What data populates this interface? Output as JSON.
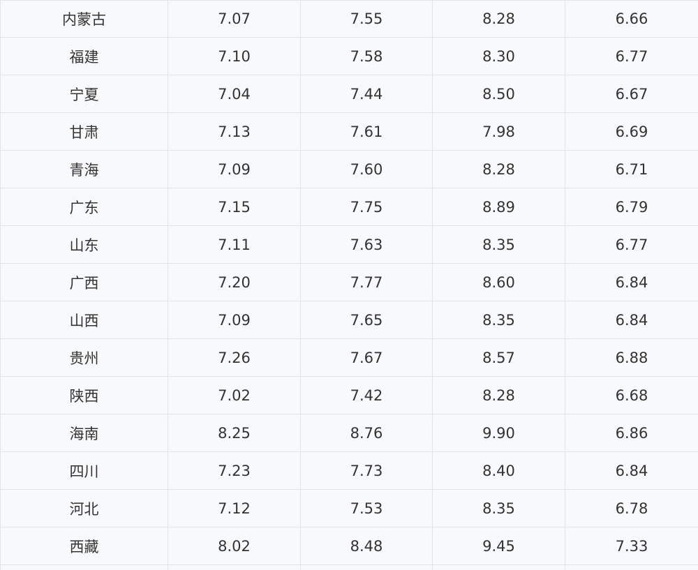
{
  "table": {
    "rows": [
      {
        "region": "内蒙古",
        "values": [
          "7.07",
          "7.55",
          "8.28",
          "6.66"
        ]
      },
      {
        "region": "福建",
        "values": [
          "7.10",
          "7.58",
          "8.30",
          "6.77"
        ]
      },
      {
        "region": "宁夏",
        "values": [
          "7.04",
          "7.44",
          "8.50",
          "6.67"
        ]
      },
      {
        "region": "甘肃",
        "values": [
          "7.13",
          "7.61",
          "7.98",
          "6.69"
        ]
      },
      {
        "region": "青海",
        "values": [
          "7.09",
          "7.60",
          "8.28",
          "6.71"
        ]
      },
      {
        "region": "广东",
        "values": [
          "7.15",
          "7.75",
          "8.89",
          "6.79"
        ]
      },
      {
        "region": "山东",
        "values": [
          "7.11",
          "7.63",
          "8.35",
          "6.77"
        ]
      },
      {
        "region": "广西",
        "values": [
          "7.20",
          "7.77",
          "8.60",
          "6.84"
        ]
      },
      {
        "region": "山西",
        "values": [
          "7.09",
          "7.65",
          "8.35",
          "6.84"
        ]
      },
      {
        "region": "贵州",
        "values": [
          "7.26",
          "7.67",
          "8.57",
          "6.88"
        ]
      },
      {
        "region": "陕西",
        "values": [
          "7.02",
          "7.42",
          "8.28",
          "6.68"
        ]
      },
      {
        "region": "海南",
        "values": [
          "8.25",
          "8.76",
          "9.90",
          "6.86"
        ]
      },
      {
        "region": "四川",
        "values": [
          "7.23",
          "7.73",
          "8.40",
          "6.84"
        ]
      },
      {
        "region": "河北",
        "values": [
          "7.12",
          "7.53",
          "8.35",
          "6.78"
        ]
      },
      {
        "region": "西藏",
        "values": [
          "8.02",
          "8.48",
          "9.45",
          "7.33"
        ]
      }
    ]
  }
}
